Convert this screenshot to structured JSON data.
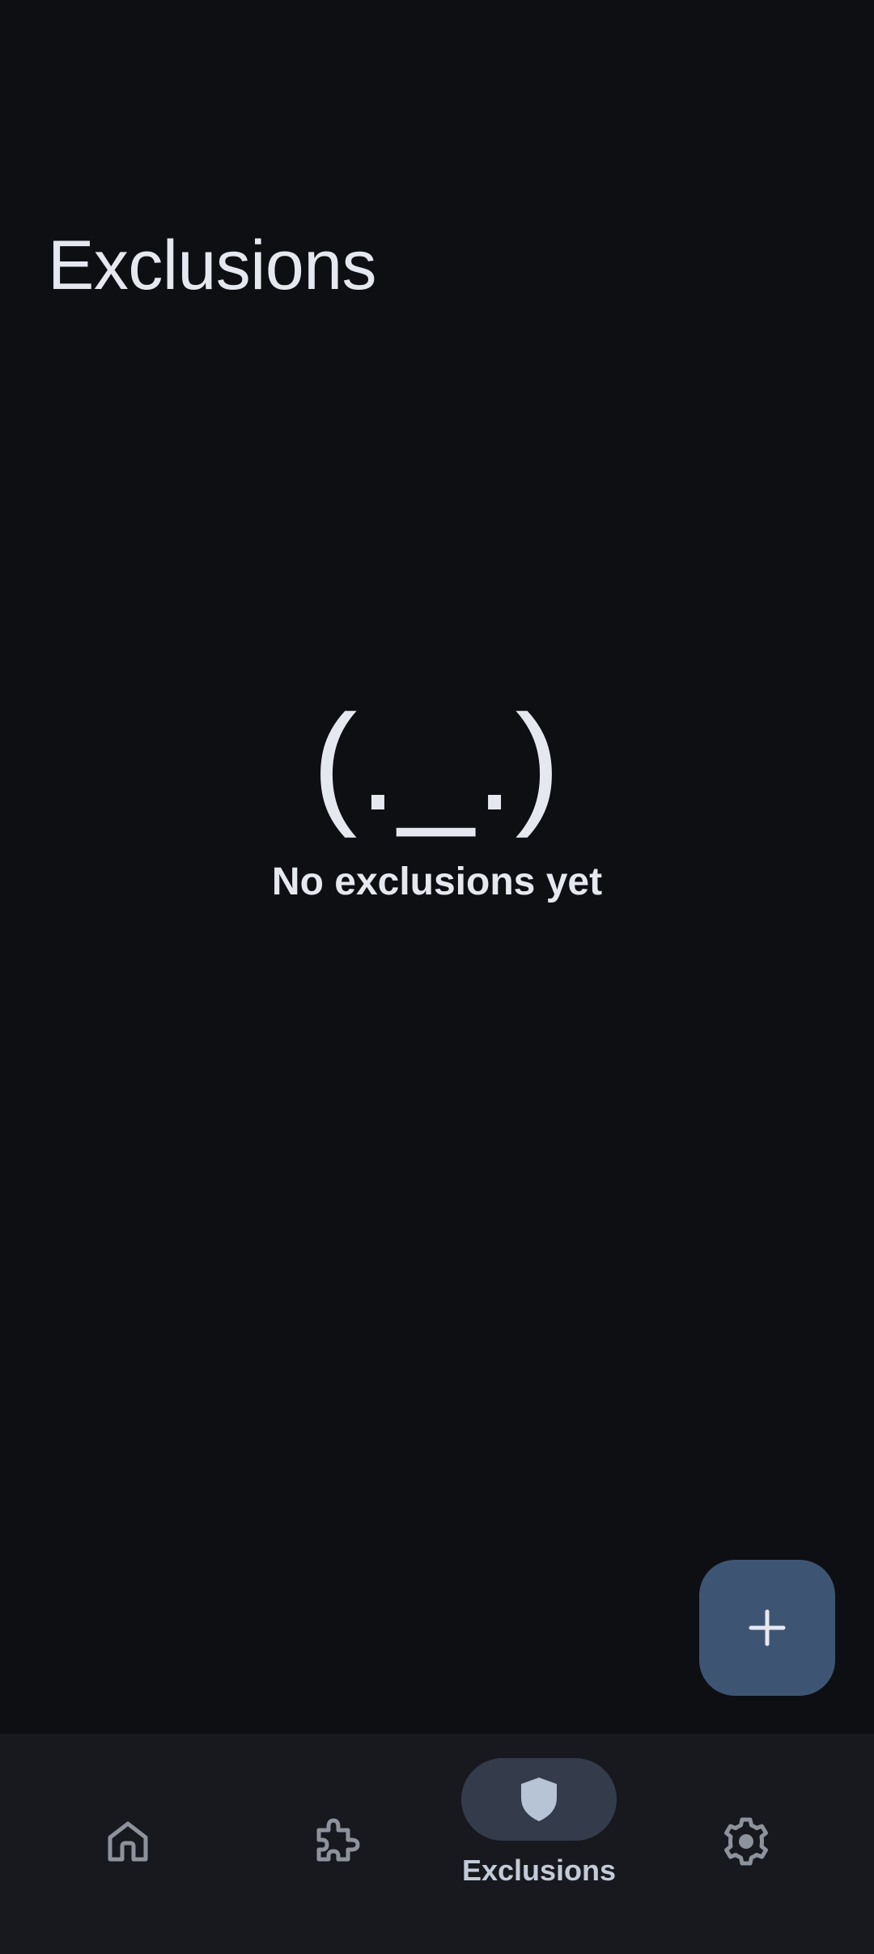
{
  "header": {
    "title": "Exclusions"
  },
  "empty_state": {
    "face": "(._.)",
    "message": "No exclusions yet"
  },
  "fab": {
    "icon": "plus-icon"
  },
  "bottom_nav": {
    "items": [
      {
        "icon": "home-icon",
        "label": "",
        "active": false
      },
      {
        "icon": "puzzle-icon",
        "label": "",
        "active": false
      },
      {
        "icon": "shield-icon",
        "label": "Exclusions",
        "active": true
      },
      {
        "icon": "gear-icon",
        "label": "",
        "active": false
      }
    ]
  },
  "colors": {
    "background": "#0e0f13",
    "nav_background": "#17191e",
    "active_pill": "#343c4b",
    "fab": "#3d5573",
    "text_primary": "#e6e8f0",
    "icon_inactive": "#8d929c",
    "icon_active": "#b7c4d6"
  }
}
